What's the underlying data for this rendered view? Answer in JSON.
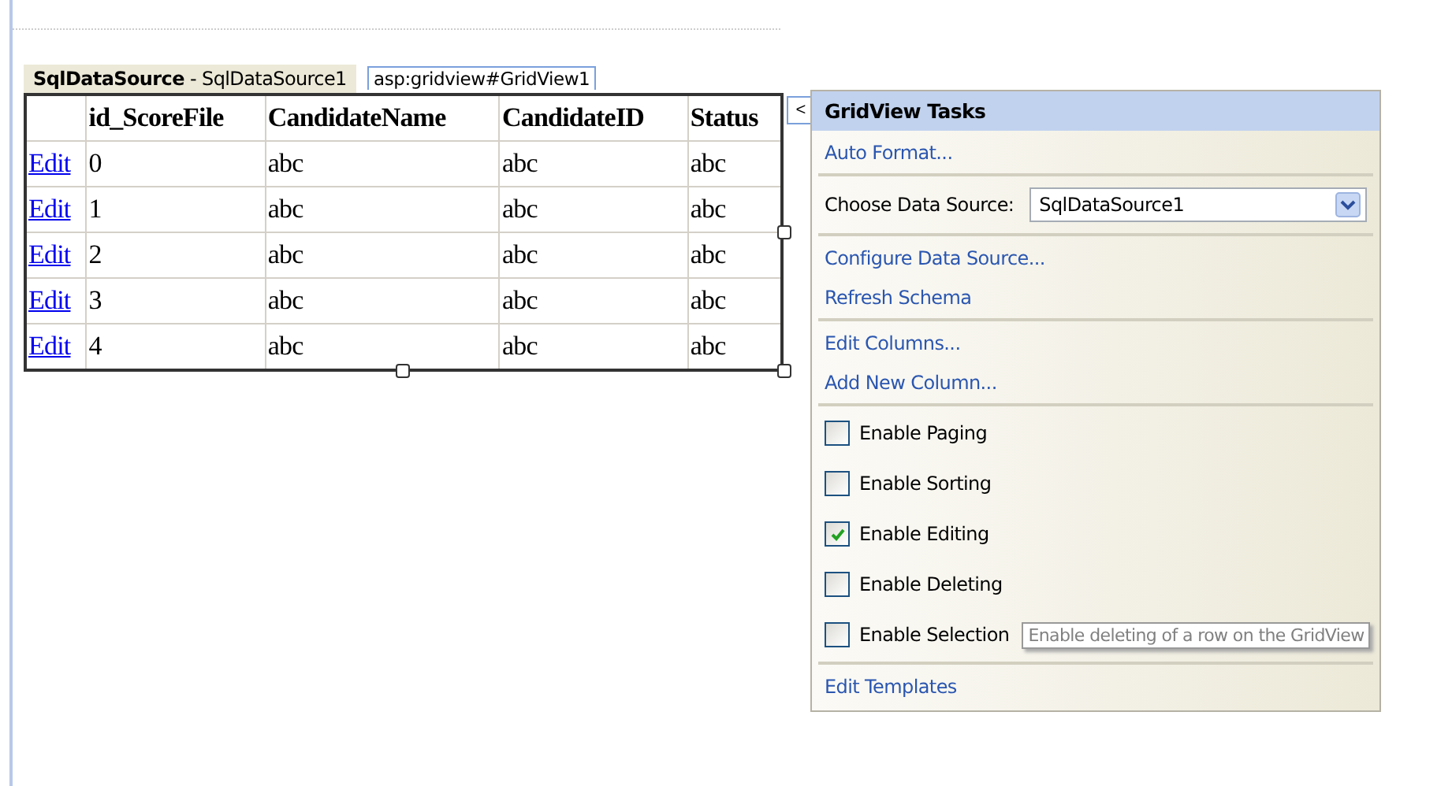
{
  "datasource_tag": {
    "type": "SqlDataSource",
    "id": "- SqlDataSource1"
  },
  "control_tag": "asp:gridview#GridView1",
  "grid": {
    "columns": [
      "id_ScoreFile",
      "CandidateName",
      "CandidateID",
      "Status"
    ],
    "rows": [
      {
        "link": "Edit",
        "cells": [
          "0",
          "abc",
          "abc",
          "abc"
        ]
      },
      {
        "link": "Edit",
        "cells": [
          "1",
          "abc",
          "abc",
          "abc"
        ]
      },
      {
        "link": "Edit",
        "cells": [
          "2",
          "abc",
          "abc",
          "abc"
        ]
      },
      {
        "link": "Edit",
        "cells": [
          "3",
          "abc",
          "abc",
          "abc"
        ]
      },
      {
        "link": "Edit",
        "cells": [
          "4",
          "abc",
          "abc",
          "abc"
        ]
      }
    ]
  },
  "collapse_button": "<",
  "tasks_panel": {
    "title": "GridView Tasks",
    "sections": [
      [
        {
          "kind": "link",
          "label": "Auto Format..."
        }
      ],
      [
        {
          "kind": "dropdown",
          "label": "Choose Data Source:",
          "value": "SqlDataSource1"
        }
      ],
      [
        {
          "kind": "link",
          "label": "Configure Data Source..."
        },
        {
          "kind": "link",
          "label": "Refresh Schema"
        }
      ],
      [
        {
          "kind": "link",
          "label": "Edit Columns..."
        },
        {
          "kind": "link",
          "label": "Add New Column..."
        }
      ],
      [
        {
          "kind": "checkbox",
          "label": "Enable Paging",
          "checked": false
        },
        {
          "kind": "checkbox",
          "label": "Enable Sorting",
          "checked": false
        },
        {
          "kind": "checkbox",
          "label": "Enable Editing",
          "checked": true
        },
        {
          "kind": "checkbox",
          "label": "Enable Deleting",
          "checked": false
        },
        {
          "kind": "checkbox",
          "label": "Enable Selection",
          "checked": false,
          "tooltip": "Enable deleting of a row on the GridView"
        }
      ],
      [
        {
          "kind": "link",
          "label": "Edit Templates"
        }
      ]
    ]
  }
}
